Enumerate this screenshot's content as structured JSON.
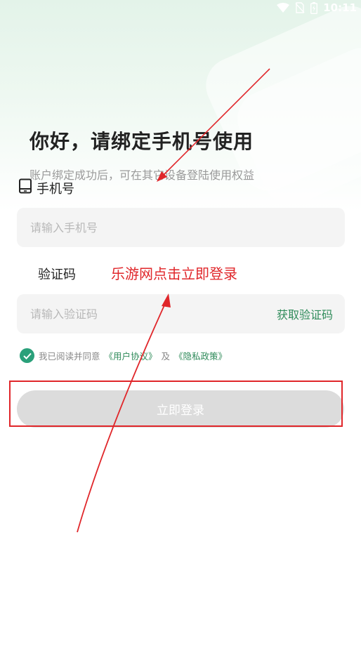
{
  "status_bar": {
    "time": "10:11",
    "icons": [
      "wifi-icon",
      "no-sim-icon",
      "battery-charging-icon"
    ]
  },
  "header": {
    "title": "你好，请绑定手机号使用",
    "subtitle": "账户绑定成功后，可在其它设备登陆使用权益"
  },
  "phone": {
    "label": "手机号",
    "icon": "tablet-icon",
    "placeholder": "请输入手机号",
    "value": ""
  },
  "code": {
    "label": "验证码",
    "placeholder": "请输入验证码",
    "value": "",
    "get_code_label": "获取验证码"
  },
  "agreement": {
    "checked": true,
    "prefix": "我已阅读并同意",
    "user_agreement": "《用户协议》",
    "and": "及",
    "privacy_policy": "《隐私政策》"
  },
  "login_button": {
    "label": "立即登录",
    "enabled": false
  },
  "annotation": {
    "text": "乐游网点击立即登录",
    "color": "#e0262a"
  },
  "colors": {
    "accent": "#2f8b5a",
    "check": "#2aa07a",
    "annotation": "#e0262a"
  }
}
